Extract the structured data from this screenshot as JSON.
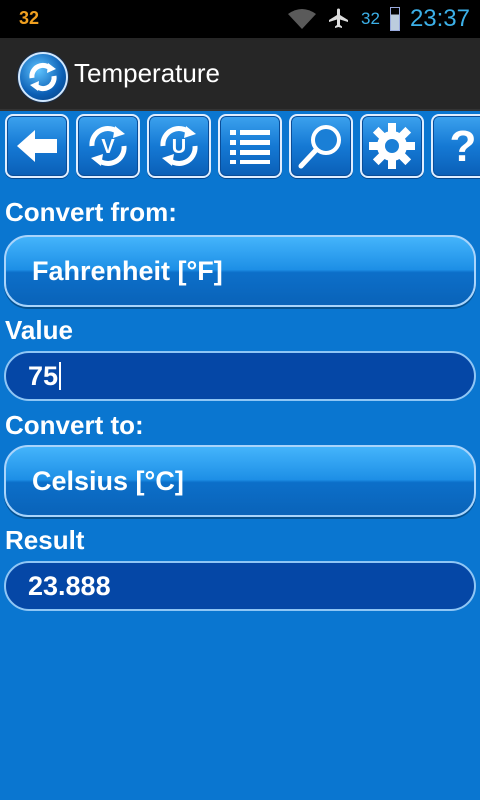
{
  "status_bar": {
    "left_number": "32",
    "battery_percent": "32",
    "time": "23:37"
  },
  "app": {
    "title": "Temperature",
    "icon": "refresh-icon"
  },
  "toolbar": {
    "buttons": [
      {
        "icon": "back-arrow-icon"
      },
      {
        "icon": "convert-v-icon",
        "glyph": "V"
      },
      {
        "icon": "convert-u-icon",
        "glyph": "U"
      },
      {
        "icon": "list-icon"
      },
      {
        "icon": "search-icon"
      },
      {
        "icon": "gear-icon"
      },
      {
        "icon": "help-icon",
        "glyph": "?"
      }
    ]
  },
  "form": {
    "from_label": "Convert from:",
    "from_value": "Fahrenheit [°F]",
    "value_label": "Value",
    "value_input": "75",
    "to_label": "Convert to:",
    "to_value": "Celsius [°C]",
    "result_label": "Result",
    "result_value": "23.888"
  },
  "colors": {
    "background": "#0a76d0",
    "button_gradient_top": "#44b4fb",
    "field_fill": "#0547a6",
    "status_accent": "#3cb0e8"
  }
}
